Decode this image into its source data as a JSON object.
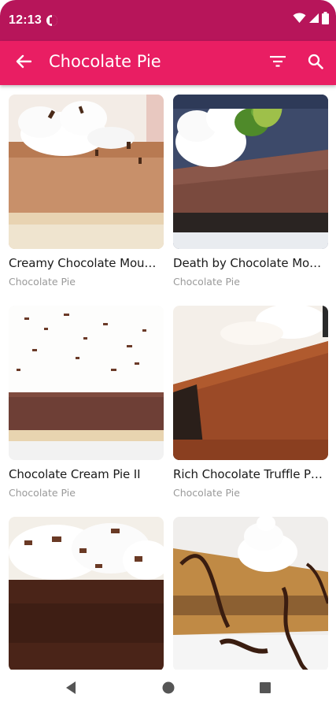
{
  "status_bar": {
    "time": "12:13",
    "icons": [
      "app-notification-icon",
      "wifi-icon",
      "cell-signal-icon",
      "battery-icon"
    ]
  },
  "app_bar": {
    "title": "Chocolate Pie",
    "back_icon": "arrow-back-icon",
    "filter_icon": "filter-icon",
    "search_icon": "search-icon",
    "background": "#e91e63",
    "status_background": "#b7155a"
  },
  "recipes": [
    {
      "title": "Creamy Chocolate Mou…",
      "category": "Chocolate Pie"
    },
    {
      "title": "Death by Chocolate Mo…",
      "category": "Chocolate Pie"
    },
    {
      "title": "Chocolate Cream Pie II",
      "category": "Chocolate Pie"
    },
    {
      "title": "Rich Chocolate Truffle P…",
      "category": "Chocolate Pie"
    },
    {
      "title": "",
      "category": ""
    },
    {
      "title": "",
      "category": ""
    }
  ],
  "nav_bar": {
    "icons": [
      "nav-back-icon",
      "nav-home-icon",
      "nav-recents-icon"
    ]
  }
}
